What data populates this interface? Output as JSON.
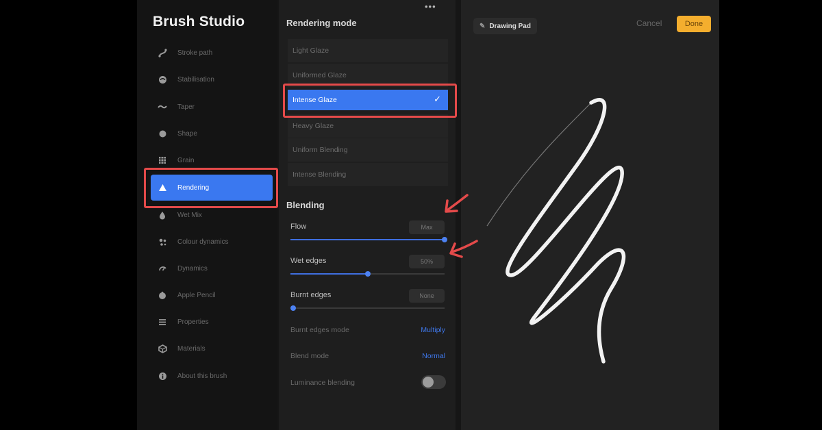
{
  "sidebar": {
    "title": "Brush Studio",
    "items": [
      {
        "label": "Stroke path",
        "icon": "stroke-path-icon"
      },
      {
        "label": "Stabilisation",
        "icon": "stabilisation-icon"
      },
      {
        "label": "Taper",
        "icon": "taper-icon"
      },
      {
        "label": "Shape",
        "icon": "shape-icon"
      },
      {
        "label": "Grain",
        "icon": "grain-icon"
      },
      {
        "label": "Rendering",
        "icon": "rendering-icon",
        "active": true
      },
      {
        "label": "Wet Mix",
        "icon": "wet-mix-icon"
      },
      {
        "label": "Colour dynamics",
        "icon": "colour-dynamics-icon"
      },
      {
        "label": "Dynamics",
        "icon": "dynamics-icon"
      },
      {
        "label": "Apple Pencil",
        "icon": "apple-pencil-icon"
      },
      {
        "label": "Properties",
        "icon": "properties-icon"
      },
      {
        "label": "Materials",
        "icon": "materials-icon"
      },
      {
        "label": "About this brush",
        "icon": "about-icon"
      }
    ]
  },
  "settings": {
    "more_label": "•••",
    "rendering_title": "Rendering mode",
    "modes": [
      {
        "label": "Light Glaze"
      },
      {
        "label": "Uniformed Glaze"
      },
      {
        "label": "Intense Glaze",
        "selected": true
      },
      {
        "label": "Heavy Glaze"
      },
      {
        "label": "Uniform Blending"
      },
      {
        "label": "Intense Blending"
      }
    ],
    "check_mark": "✓",
    "blending_title": "Blending",
    "flow": {
      "label": "Flow",
      "value_text": "Max",
      "value": 1.0
    },
    "wet_edges": {
      "label": "Wet edges",
      "value_text": "50%",
      "value": 0.5
    },
    "burnt_edges": {
      "label": "Burnt edges",
      "value_text": "None",
      "value": 0.0
    },
    "burnt_edges_mode": {
      "label": "Burnt edges mode",
      "value": "Multiply"
    },
    "blend_mode": {
      "label": "Blend mode",
      "value": "Normal"
    },
    "luminance_blending": {
      "label": "Luminance blending",
      "on": false
    }
  },
  "pad": {
    "button_label": "Drawing Pad",
    "button_icon": "edit-icon",
    "cancel_label": "Cancel",
    "done_label": "Done"
  },
  "colors": {
    "accent": "#3a78f0",
    "done": "#f4ae2e",
    "highlight": "#e44a4a"
  }
}
